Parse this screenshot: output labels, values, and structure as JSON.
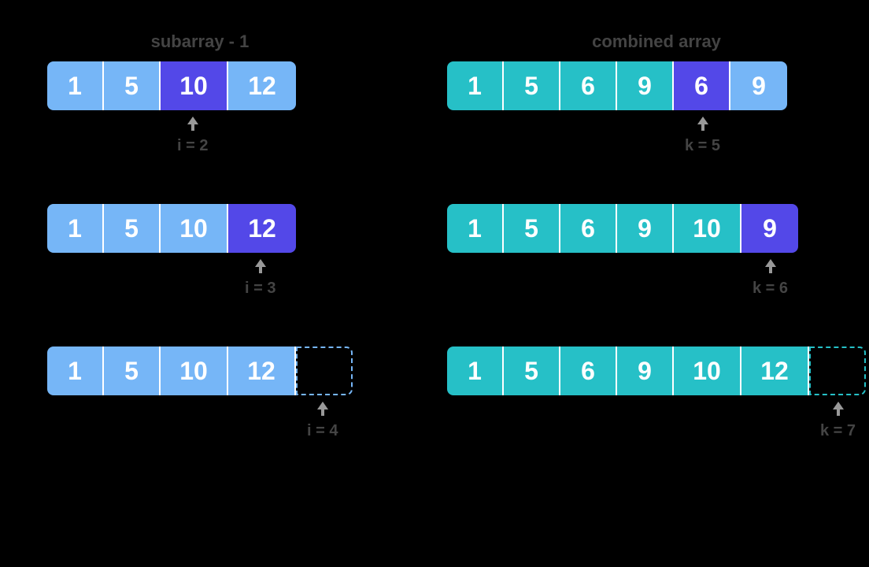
{
  "left": {
    "heading": "subarray - 1",
    "rows": [
      {
        "cells": [
          {
            "v": "1",
            "color": "lightblue",
            "wide": false
          },
          {
            "v": "5",
            "color": "lightblue",
            "wide": false
          },
          {
            "v": "10",
            "color": "indigo",
            "wide": true
          },
          {
            "v": "12",
            "color": "lightblue",
            "wide": true
          }
        ],
        "pointer_index": 2,
        "pointer_label": "i = 2"
      },
      {
        "cells": [
          {
            "v": "1",
            "color": "lightblue",
            "wide": false
          },
          {
            "v": "5",
            "color": "lightblue",
            "wide": false
          },
          {
            "v": "10",
            "color": "lightblue",
            "wide": true
          },
          {
            "v": "12",
            "color": "indigo",
            "wide": true
          }
        ],
        "pointer_index": 3,
        "pointer_label": "i = 3"
      },
      {
        "cells": [
          {
            "v": "1",
            "color": "lightblue",
            "wide": false
          },
          {
            "v": "5",
            "color": "lightblue",
            "wide": false
          },
          {
            "v": "10",
            "color": "lightblue",
            "wide": true
          },
          {
            "v": "12",
            "color": "lightblue",
            "wide": true
          },
          {
            "v": "",
            "color": "empty",
            "wide": false
          }
        ],
        "pointer_index": 4,
        "pointer_label": "i = 4"
      }
    ]
  },
  "right": {
    "heading": "combined array",
    "rows": [
      {
        "cells": [
          {
            "v": "1",
            "color": "teal",
            "wide": false
          },
          {
            "v": "5",
            "color": "teal",
            "wide": false
          },
          {
            "v": "6",
            "color": "teal",
            "wide": false
          },
          {
            "v": "9",
            "color": "teal",
            "wide": false
          },
          {
            "v": "6",
            "color": "indigo",
            "wide": false
          },
          {
            "v": "9",
            "color": "lightblue",
            "wide": false
          }
        ],
        "pointer_index": 4,
        "pointer_label": "k = 5"
      },
      {
        "cells": [
          {
            "v": "1",
            "color": "teal",
            "wide": false
          },
          {
            "v": "5",
            "color": "teal",
            "wide": false
          },
          {
            "v": "6",
            "color": "teal",
            "wide": false
          },
          {
            "v": "9",
            "color": "teal",
            "wide": false
          },
          {
            "v": "10",
            "color": "teal",
            "wide": true
          },
          {
            "v": "9",
            "color": "indigo",
            "wide": false
          }
        ],
        "pointer_index": 5,
        "pointer_label": "k = 6"
      },
      {
        "cells": [
          {
            "v": "1",
            "color": "teal",
            "wide": false
          },
          {
            "v": "5",
            "color": "teal",
            "wide": false
          },
          {
            "v": "6",
            "color": "teal",
            "wide": false
          },
          {
            "v": "9",
            "color": "teal",
            "wide": false
          },
          {
            "v": "10",
            "color": "teal",
            "wide": true
          },
          {
            "v": "12",
            "color": "teal",
            "wide": true
          },
          {
            "v": "",
            "color": "empty-teal",
            "wide": false
          }
        ],
        "pointer_index": 6,
        "pointer_label": "k = 7"
      }
    ]
  }
}
